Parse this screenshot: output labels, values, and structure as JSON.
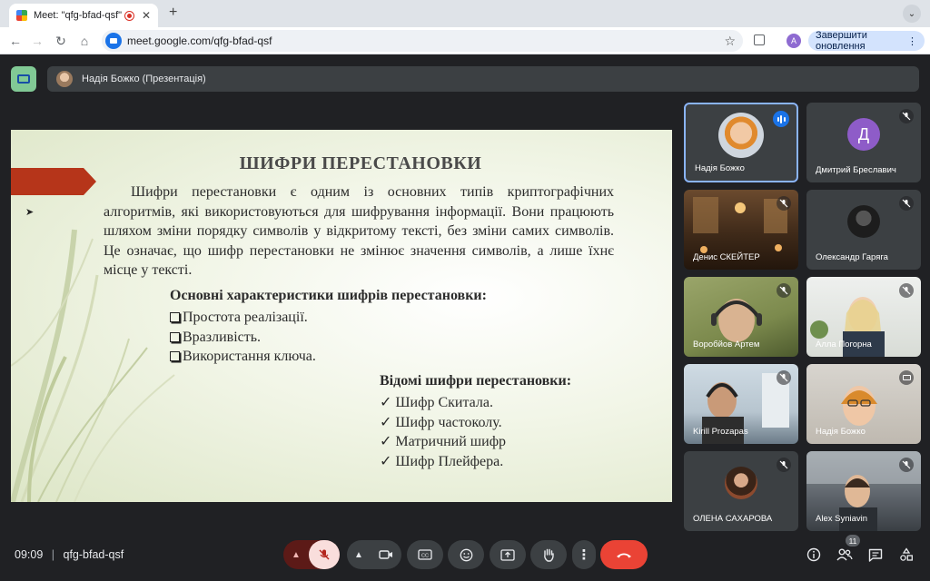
{
  "browser": {
    "tab_title": "Meet: \"qfg-bfad-qsf\"",
    "url": "meet.google.com/qfg-bfad-qsf",
    "profile_initial": "A",
    "update_button": "Завершити оновлення"
  },
  "meet": {
    "presenter_label": "Надія Божко (Презентація)",
    "time": "09:09",
    "meeting_code": "qfg-bfad-qsf",
    "participants_count": "11",
    "accent_color": "#8ab4f8",
    "end_call_color": "#ea4335"
  },
  "slide": {
    "title": "ШИФРИ ПЕРЕСТАНОВКИ",
    "paragraph": "Шифри перестановки є одним із основних типів криптографічних алгоритмів, які використовуються для шифрування інформації. Вони працюють шляхом зміни порядку символів у відкритому тексті, без зміни самих символів. Це означає, що шифр перестановки не змінює значення символів, а лише їхнє місце у тексті.",
    "characteristics_heading": "Основні характеристики шифрів перестановки:",
    "characteristics": [
      "Простота реалізації.",
      "Вразливість.",
      "Використання ключа."
    ],
    "known_heading": "Відомі шифри перестановки:",
    "known": [
      "Шифр Скитала.",
      "Шифр частоколу.",
      "Матричний шифр",
      "Шифр Плейфера."
    ]
  },
  "participants": [
    {
      "name": "Надія Божко",
      "mic": "speaking"
    },
    {
      "name": "Дмитрий Бреславич",
      "initial": "Д",
      "mic": "muted"
    },
    {
      "name": "Денис СКЕЙТЕР",
      "mic": "muted"
    },
    {
      "name": "Олександр Гаряга",
      "mic": "muted"
    },
    {
      "name": "Воробйов Артем",
      "mic": "muted"
    },
    {
      "name": "Алла Погорна",
      "mic": "muted"
    },
    {
      "name": "Kirill Prozapas",
      "mic": "muted"
    },
    {
      "name": "Надія Божко",
      "mic": "presenting"
    },
    {
      "name": "ОЛЕНА САХАРОВА",
      "mic": "muted"
    },
    {
      "name": "Alex Syniavin",
      "mic": "muted"
    }
  ]
}
